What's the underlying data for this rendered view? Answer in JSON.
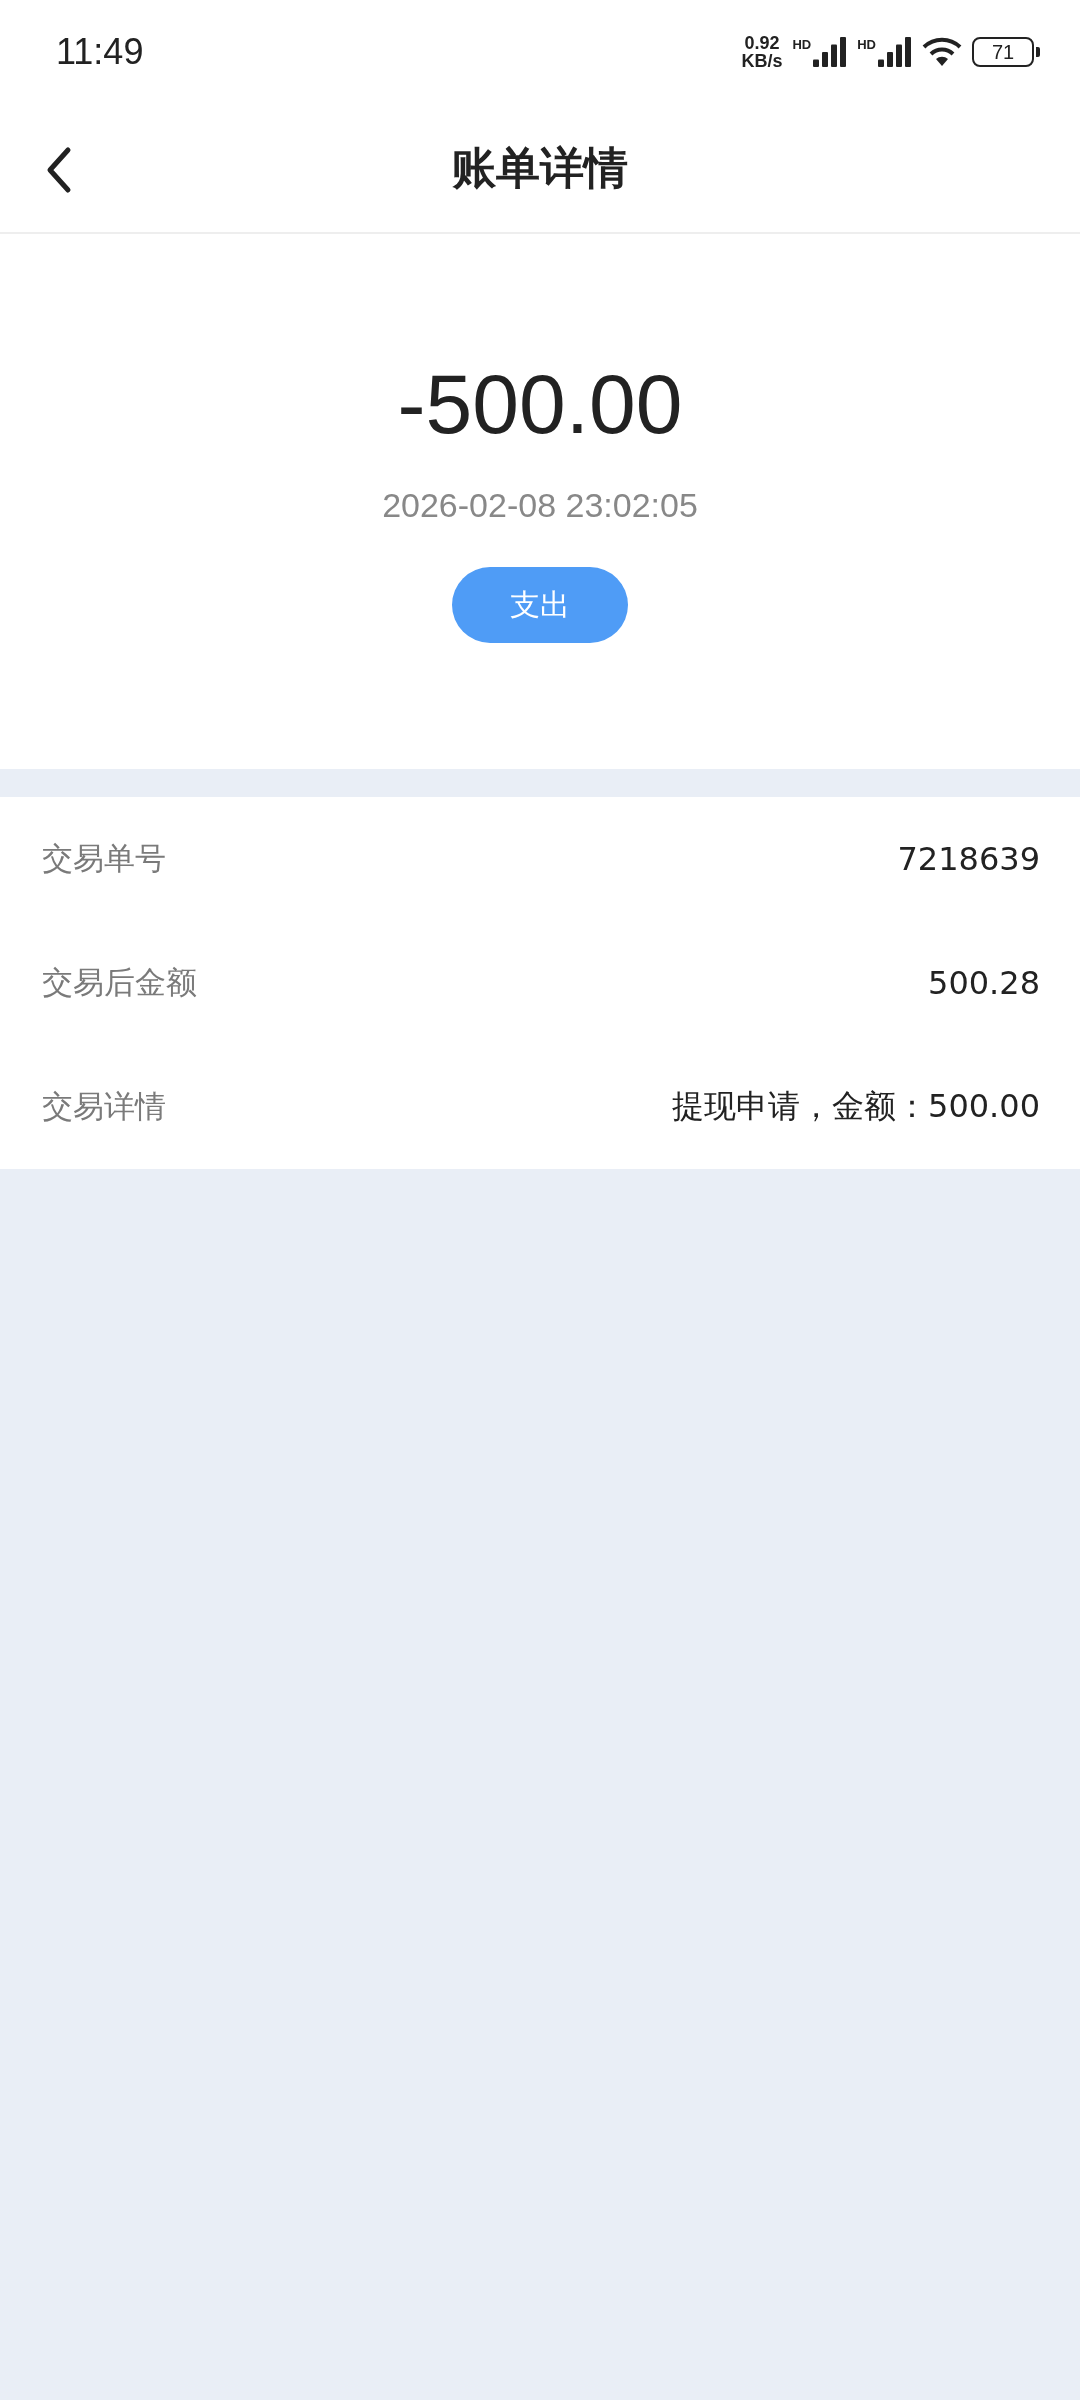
{
  "status_bar": {
    "time": "11:49",
    "net_speed": "0.92",
    "net_unit": "KB/s",
    "signals": [
      "HD",
      "HD"
    ],
    "battery": "71"
  },
  "header": {
    "title": "账单详情"
  },
  "summary": {
    "amount": "-500.00",
    "time": "2026-02-08 23:02:05",
    "tag": "支出"
  },
  "details": [
    {
      "label": "交易单号",
      "value": "7218639"
    },
    {
      "label": "交易后金额",
      "value": "500.28"
    },
    {
      "label": "交易详情",
      "value": "提现申请，金额：500.00"
    }
  ]
}
